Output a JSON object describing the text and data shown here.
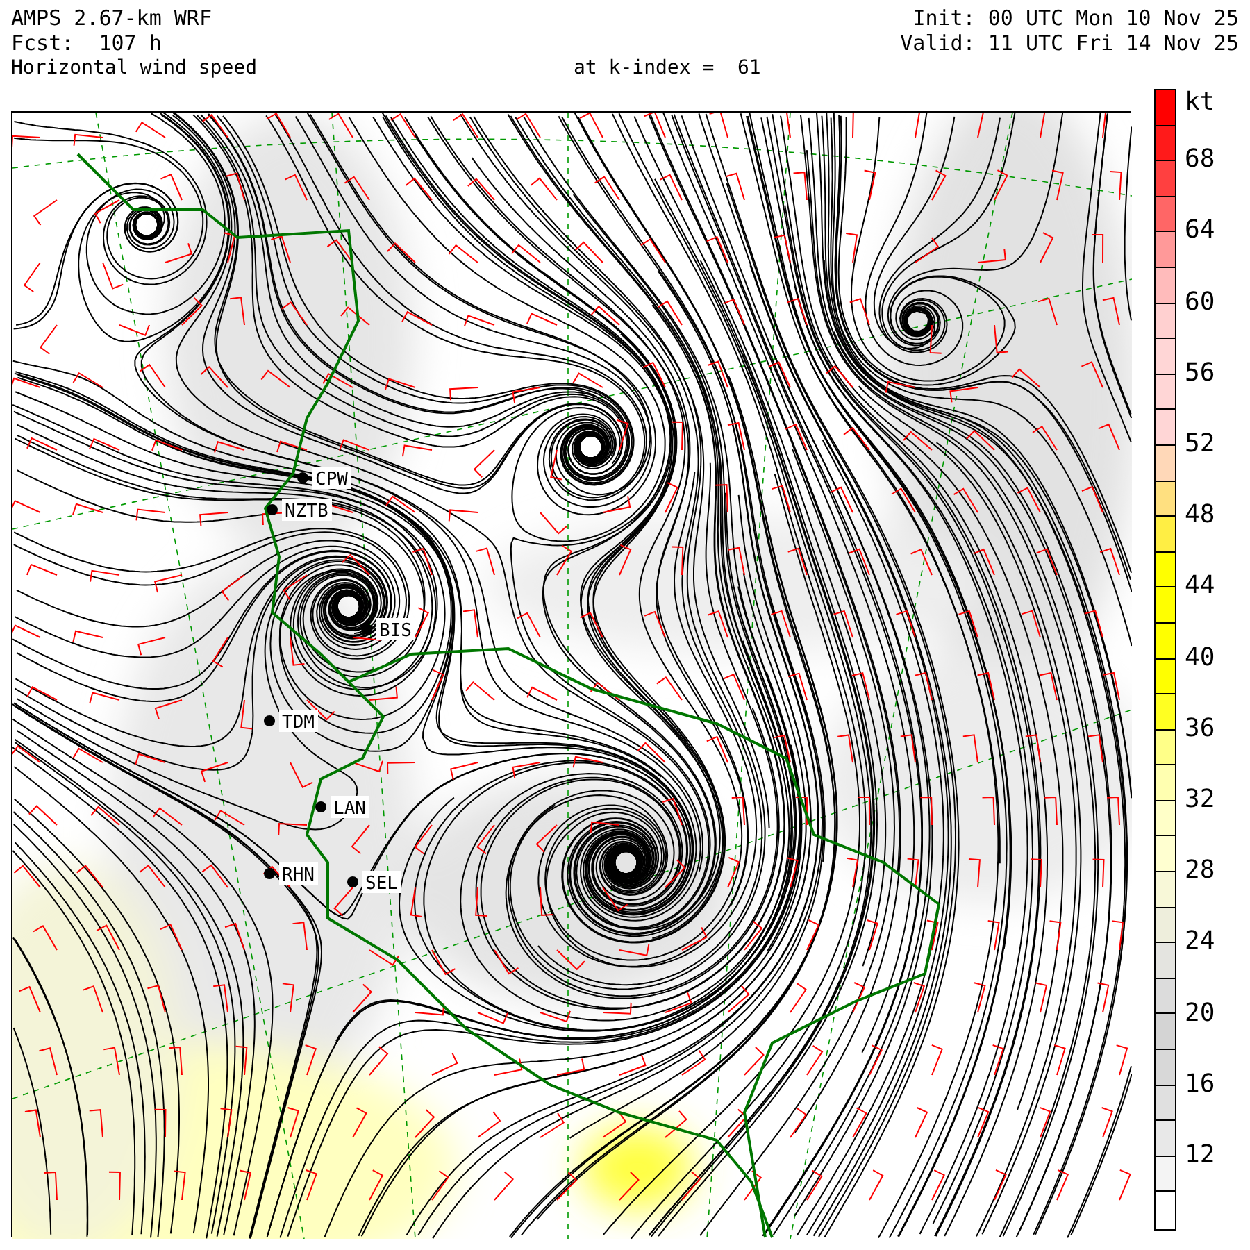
{
  "header": {
    "model": "AMPS 2.67-km WRF",
    "forecast": "Fcst:  107 h",
    "field": "Horizontal wind speed",
    "level": "at k-index =  61",
    "init": "Init: 00 UTC Mon 10 Nov 25",
    "valid": "Valid: 11 UTC Fri 14 Nov 25"
  },
  "stations": [
    {
      "label": "CPW"
    },
    {
      "label": "NZTB"
    },
    {
      "label": "BIS"
    },
    {
      "label": "TDM"
    },
    {
      "label": "LAN"
    },
    {
      "label": "RHN"
    },
    {
      "label": "SEL"
    }
  ],
  "color_scale": {
    "unit": "kt",
    "swatches": [
      {
        "color": "#ff0000"
      },
      {
        "color": "#ff1a1a"
      },
      {
        "color": "#ff4040"
      },
      {
        "color": "#ff6666"
      },
      {
        "color": "#ff9999"
      },
      {
        "color": "#ffbbbb"
      },
      {
        "color": "#ffd0d0"
      },
      {
        "color": "#ffd6d6"
      },
      {
        "color": "#ffd6d6"
      },
      {
        "color": "#ffd6d6"
      },
      {
        "color": "#ffd8b8"
      },
      {
        "color": "#ffe080"
      },
      {
        "color": "#ffee44"
      },
      {
        "color": "#ffff00"
      },
      {
        "color": "#ffff00"
      },
      {
        "color": "#ffff00"
      },
      {
        "color": "#ffff00"
      },
      {
        "color": "#ffff22"
      },
      {
        "color": "#ffff88"
      },
      {
        "color": "#ffffb0"
      },
      {
        "color": "#ffffc8"
      },
      {
        "color": "#ffffd0"
      },
      {
        "color": "#f8f8d8"
      },
      {
        "color": "#eeeedc"
      },
      {
        "color": "#e4e4e0"
      },
      {
        "color": "#dcdcdc"
      },
      {
        "color": "#d4d4d4"
      },
      {
        "color": "#d8d8d8"
      },
      {
        "color": "#e0e0e0"
      },
      {
        "color": "#e8e8e8"
      },
      {
        "color": "#f4f4f4"
      },
      {
        "color": "#ffffff"
      }
    ],
    "labels": [
      "68",
      "64",
      "60",
      "56",
      "52",
      "48",
      "44",
      "40",
      "36",
      "32",
      "28",
      "24",
      "20",
      "16",
      "12"
    ]
  }
}
